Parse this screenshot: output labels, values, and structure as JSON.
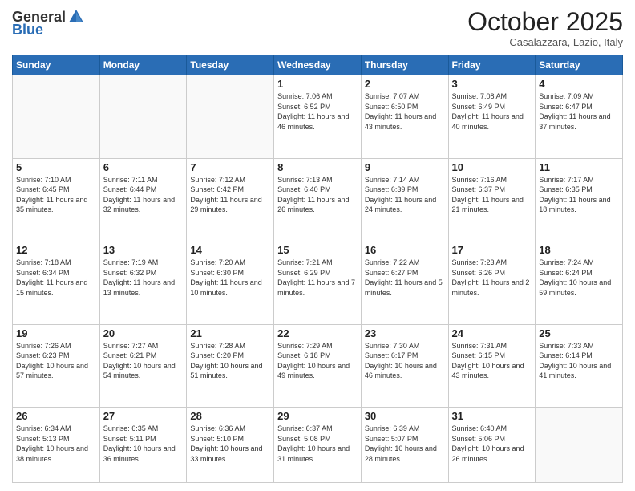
{
  "header": {
    "logo_general": "General",
    "logo_blue": "Blue",
    "month": "October 2025",
    "location": "Casalazzara, Lazio, Italy"
  },
  "days_of_week": [
    "Sunday",
    "Monday",
    "Tuesday",
    "Wednesday",
    "Thursday",
    "Friday",
    "Saturday"
  ],
  "weeks": [
    [
      {
        "day": "",
        "info": ""
      },
      {
        "day": "",
        "info": ""
      },
      {
        "day": "",
        "info": ""
      },
      {
        "day": "1",
        "info": "Sunrise: 7:06 AM\nSunset: 6:52 PM\nDaylight: 11 hours and 46 minutes."
      },
      {
        "day": "2",
        "info": "Sunrise: 7:07 AM\nSunset: 6:50 PM\nDaylight: 11 hours and 43 minutes."
      },
      {
        "day": "3",
        "info": "Sunrise: 7:08 AM\nSunset: 6:49 PM\nDaylight: 11 hours and 40 minutes."
      },
      {
        "day": "4",
        "info": "Sunrise: 7:09 AM\nSunset: 6:47 PM\nDaylight: 11 hours and 37 minutes."
      }
    ],
    [
      {
        "day": "5",
        "info": "Sunrise: 7:10 AM\nSunset: 6:45 PM\nDaylight: 11 hours and 35 minutes."
      },
      {
        "day": "6",
        "info": "Sunrise: 7:11 AM\nSunset: 6:44 PM\nDaylight: 11 hours and 32 minutes."
      },
      {
        "day": "7",
        "info": "Sunrise: 7:12 AM\nSunset: 6:42 PM\nDaylight: 11 hours and 29 minutes."
      },
      {
        "day": "8",
        "info": "Sunrise: 7:13 AM\nSunset: 6:40 PM\nDaylight: 11 hours and 26 minutes."
      },
      {
        "day": "9",
        "info": "Sunrise: 7:14 AM\nSunset: 6:39 PM\nDaylight: 11 hours and 24 minutes."
      },
      {
        "day": "10",
        "info": "Sunrise: 7:16 AM\nSunset: 6:37 PM\nDaylight: 11 hours and 21 minutes."
      },
      {
        "day": "11",
        "info": "Sunrise: 7:17 AM\nSunset: 6:35 PM\nDaylight: 11 hours and 18 minutes."
      }
    ],
    [
      {
        "day": "12",
        "info": "Sunrise: 7:18 AM\nSunset: 6:34 PM\nDaylight: 11 hours and 15 minutes."
      },
      {
        "day": "13",
        "info": "Sunrise: 7:19 AM\nSunset: 6:32 PM\nDaylight: 11 hours and 13 minutes."
      },
      {
        "day": "14",
        "info": "Sunrise: 7:20 AM\nSunset: 6:30 PM\nDaylight: 11 hours and 10 minutes."
      },
      {
        "day": "15",
        "info": "Sunrise: 7:21 AM\nSunset: 6:29 PM\nDaylight: 11 hours and 7 minutes."
      },
      {
        "day": "16",
        "info": "Sunrise: 7:22 AM\nSunset: 6:27 PM\nDaylight: 11 hours and 5 minutes."
      },
      {
        "day": "17",
        "info": "Sunrise: 7:23 AM\nSunset: 6:26 PM\nDaylight: 11 hours and 2 minutes."
      },
      {
        "day": "18",
        "info": "Sunrise: 7:24 AM\nSunset: 6:24 PM\nDaylight: 10 hours and 59 minutes."
      }
    ],
    [
      {
        "day": "19",
        "info": "Sunrise: 7:26 AM\nSunset: 6:23 PM\nDaylight: 10 hours and 57 minutes."
      },
      {
        "day": "20",
        "info": "Sunrise: 7:27 AM\nSunset: 6:21 PM\nDaylight: 10 hours and 54 minutes."
      },
      {
        "day": "21",
        "info": "Sunrise: 7:28 AM\nSunset: 6:20 PM\nDaylight: 10 hours and 51 minutes."
      },
      {
        "day": "22",
        "info": "Sunrise: 7:29 AM\nSunset: 6:18 PM\nDaylight: 10 hours and 49 minutes."
      },
      {
        "day": "23",
        "info": "Sunrise: 7:30 AM\nSunset: 6:17 PM\nDaylight: 10 hours and 46 minutes."
      },
      {
        "day": "24",
        "info": "Sunrise: 7:31 AM\nSunset: 6:15 PM\nDaylight: 10 hours and 43 minutes."
      },
      {
        "day": "25",
        "info": "Sunrise: 7:33 AM\nSunset: 6:14 PM\nDaylight: 10 hours and 41 minutes."
      }
    ],
    [
      {
        "day": "26",
        "info": "Sunrise: 6:34 AM\nSunset: 5:13 PM\nDaylight: 10 hours and 38 minutes."
      },
      {
        "day": "27",
        "info": "Sunrise: 6:35 AM\nSunset: 5:11 PM\nDaylight: 10 hours and 36 minutes."
      },
      {
        "day": "28",
        "info": "Sunrise: 6:36 AM\nSunset: 5:10 PM\nDaylight: 10 hours and 33 minutes."
      },
      {
        "day": "29",
        "info": "Sunrise: 6:37 AM\nSunset: 5:08 PM\nDaylight: 10 hours and 31 minutes."
      },
      {
        "day": "30",
        "info": "Sunrise: 6:39 AM\nSunset: 5:07 PM\nDaylight: 10 hours and 28 minutes."
      },
      {
        "day": "31",
        "info": "Sunrise: 6:40 AM\nSunset: 5:06 PM\nDaylight: 10 hours and 26 minutes."
      },
      {
        "day": "",
        "info": ""
      }
    ]
  ]
}
